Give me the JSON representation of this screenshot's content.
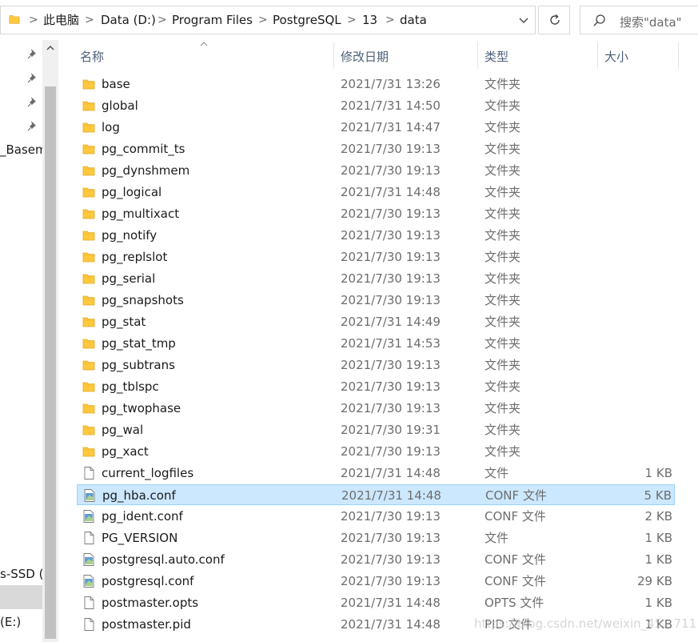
{
  "address_bar": {
    "breadcrumbs": [
      "此电脑",
      "Data (D:)",
      "Program Files",
      "PostgreSQL",
      "13",
      "data"
    ]
  },
  "search": {
    "placeholder": "搜索\"data\""
  },
  "nav_pane": {
    "items": [
      {
        "label": "_Basema"
      },
      {
        "label": "s-SSD (C"
      },
      {
        "label": "(E:)"
      }
    ]
  },
  "columns": {
    "name": "名称",
    "date": "修改日期",
    "type": "类型",
    "size": "大小"
  },
  "files": [
    {
      "name": "base",
      "date": "2021/7/31 13:26",
      "type": "文件夹",
      "size": "",
      "icon": "folder-icon"
    },
    {
      "name": "global",
      "date": "2021/7/31 14:50",
      "type": "文件夹",
      "size": "",
      "icon": "folder-icon"
    },
    {
      "name": "log",
      "date": "2021/7/31 14:47",
      "type": "文件夹",
      "size": "",
      "icon": "folder-icon"
    },
    {
      "name": "pg_commit_ts",
      "date": "2021/7/30 19:13",
      "type": "文件夹",
      "size": "",
      "icon": "folder-icon"
    },
    {
      "name": "pg_dynshmem",
      "date": "2021/7/30 19:13",
      "type": "文件夹",
      "size": "",
      "icon": "folder-icon"
    },
    {
      "name": "pg_logical",
      "date": "2021/7/31 14:48",
      "type": "文件夹",
      "size": "",
      "icon": "folder-icon"
    },
    {
      "name": "pg_multixact",
      "date": "2021/7/30 19:13",
      "type": "文件夹",
      "size": "",
      "icon": "folder-icon"
    },
    {
      "name": "pg_notify",
      "date": "2021/7/30 19:13",
      "type": "文件夹",
      "size": "",
      "icon": "folder-icon"
    },
    {
      "name": "pg_replslot",
      "date": "2021/7/30 19:13",
      "type": "文件夹",
      "size": "",
      "icon": "folder-icon"
    },
    {
      "name": "pg_serial",
      "date": "2021/7/30 19:13",
      "type": "文件夹",
      "size": "",
      "icon": "folder-icon"
    },
    {
      "name": "pg_snapshots",
      "date": "2021/7/30 19:13",
      "type": "文件夹",
      "size": "",
      "icon": "folder-icon"
    },
    {
      "name": "pg_stat",
      "date": "2021/7/31 14:49",
      "type": "文件夹",
      "size": "",
      "icon": "folder-icon"
    },
    {
      "name": "pg_stat_tmp",
      "date": "2021/7/31 14:53",
      "type": "文件夹",
      "size": "",
      "icon": "folder-icon"
    },
    {
      "name": "pg_subtrans",
      "date": "2021/7/30 19:13",
      "type": "文件夹",
      "size": "",
      "icon": "folder-icon"
    },
    {
      "name": "pg_tblspc",
      "date": "2021/7/30 19:13",
      "type": "文件夹",
      "size": "",
      "icon": "folder-icon"
    },
    {
      "name": "pg_twophase",
      "date": "2021/7/30 19:13",
      "type": "文件夹",
      "size": "",
      "icon": "folder-icon"
    },
    {
      "name": "pg_wal",
      "date": "2021/7/30 19:31",
      "type": "文件夹",
      "size": "",
      "icon": "folder-icon"
    },
    {
      "name": "pg_xact",
      "date": "2021/7/30 19:13",
      "type": "文件夹",
      "size": "",
      "icon": "folder-icon"
    },
    {
      "name": "current_logfiles",
      "date": "2021/7/31 14:48",
      "type": "文件",
      "size": "1 KB",
      "icon": "file-icon"
    },
    {
      "name": "pg_hba.conf",
      "date": "2021/7/31 14:48",
      "type": "CONF 文件",
      "size": "5 KB",
      "icon": "conf-file-icon",
      "selected": true
    },
    {
      "name": "pg_ident.conf",
      "date": "2021/7/30 19:13",
      "type": "CONF 文件",
      "size": "2 KB",
      "icon": "conf-file-icon"
    },
    {
      "name": "PG_VERSION",
      "date": "2021/7/30 19:13",
      "type": "文件",
      "size": "1 KB",
      "icon": "file-icon"
    },
    {
      "name": "postgresql.auto.conf",
      "date": "2021/7/30 19:13",
      "type": "CONF 文件",
      "size": "1 KB",
      "icon": "conf-file-icon"
    },
    {
      "name": "postgresql.conf",
      "date": "2021/7/30 19:13",
      "type": "CONF 文件",
      "size": "29 KB",
      "icon": "conf-file-icon"
    },
    {
      "name": "postmaster.opts",
      "date": "2021/7/31 14:48",
      "type": "OPTS 文件",
      "size": "1 KB",
      "icon": "file-icon"
    },
    {
      "name": "postmaster.pid",
      "date": "2021/7/31 14:48",
      "type": "PID 文件",
      "size": "1 KB",
      "icon": "file-icon"
    }
  ],
  "watermark": "https://blog.csdn.net/weixin_45...711",
  "colors": {
    "selection_bg": "#cce8ff",
    "selection_border": "#99d1ff",
    "header_text": "#4c607a",
    "folder": "#ffc83d"
  }
}
